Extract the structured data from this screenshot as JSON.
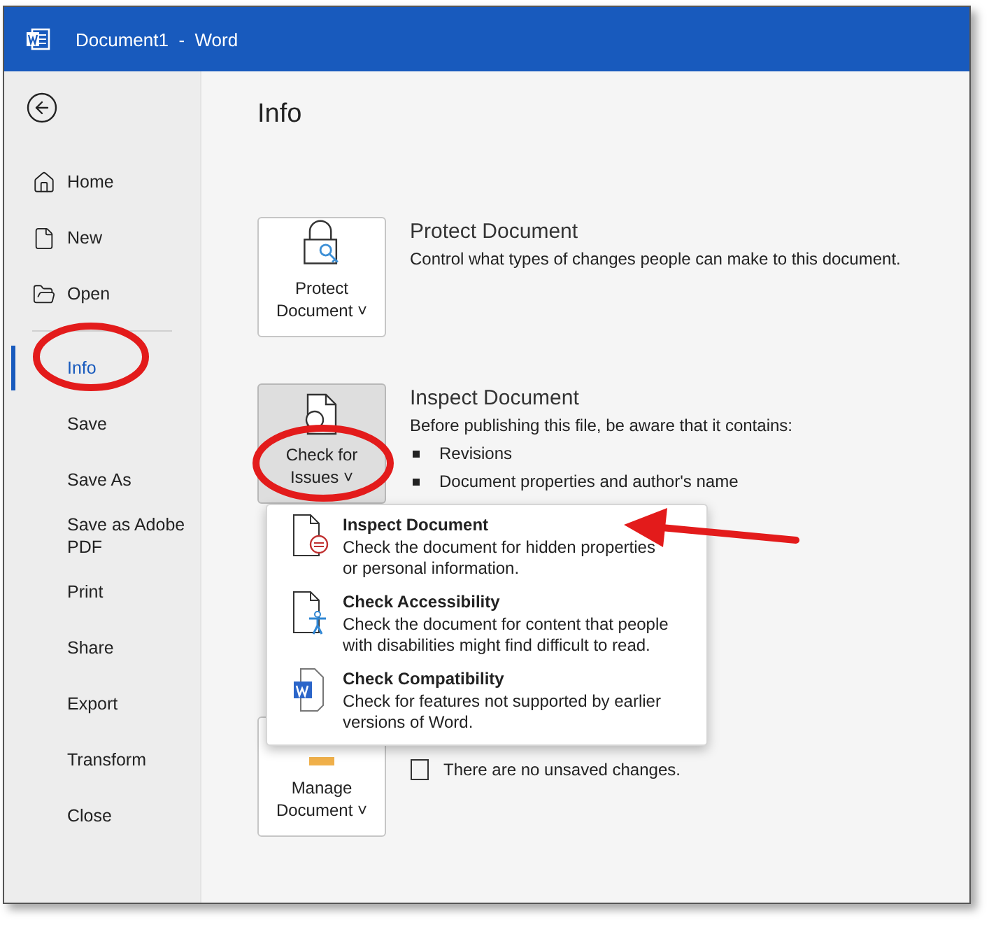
{
  "window": {
    "title": "Document1  -  Word"
  },
  "sidebar": {
    "items": [
      {
        "label": "Home",
        "selected": false
      },
      {
        "label": "New",
        "selected": false
      },
      {
        "label": "Open",
        "selected": false
      },
      {
        "kind": "divider"
      },
      {
        "label": "Info",
        "selected": true
      },
      {
        "label": "Save",
        "selected": false
      },
      {
        "label": "Save As",
        "selected": false
      },
      {
        "label": "Save as Adobe PDF",
        "selected": false
      },
      {
        "label": "Print",
        "selected": false
      },
      {
        "label": "Share",
        "selected": false
      },
      {
        "label": "Export",
        "selected": false
      },
      {
        "label": "Transform",
        "selected": false
      },
      {
        "label": "Close",
        "selected": false
      }
    ]
  },
  "page_title": "Info",
  "sections": [
    {
      "button": {
        "lines": [
          "Protect",
          "Document"
        ],
        "caret": "˅",
        "selected": false
      },
      "title": "Protect Document",
      "description": "Control what types of changes people can make to this document."
    },
    {
      "button": {
        "lines": [
          "Check for",
          "Issues"
        ],
        "caret": "˅",
        "selected": true
      },
      "title": "Inspect Document",
      "description": "Before publishing this file, be aware that it contains:",
      "bullets": [
        "Revisions",
        "Document properties and author's name"
      ]
    },
    {
      "button": {
        "lines": [
          "Manage",
          "Document"
        ],
        "caret": "˅",
        "selected": false
      },
      "status": "There are no unsaved changes."
    }
  ],
  "dropdown": {
    "items": [
      {
        "title": "Inspect Document",
        "description": [
          "Check the document for hidden properties",
          "or personal information."
        ]
      },
      {
        "title": "Check Accessibility",
        "description": [
          "Check the document for content that people",
          "with disabilities might find difficult to read."
        ]
      },
      {
        "title": "Check Compatibility",
        "description": [
          "Check for features not supported by earlier",
          "versions of Word."
        ]
      }
    ]
  }
}
